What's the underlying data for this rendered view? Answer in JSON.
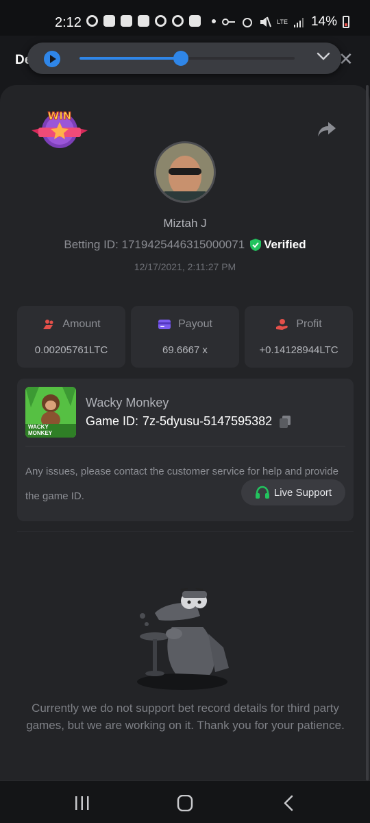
{
  "status_bar": {
    "time": "2:12",
    "network": "LTE",
    "battery": "14%"
  },
  "header": {
    "title": "Details",
    "close_icon": "close-icon"
  },
  "media_player": {
    "progress": 0.47,
    "accent_color": "#2f86e8"
  },
  "bet": {
    "user_name": "Miztah J",
    "betting_id_label": "Betting ID: 1719425446315000071",
    "verified_label": "Verified",
    "date": "12/17/2021, 2:11:27 PM"
  },
  "stats": [
    {
      "label": "Amount",
      "value": "0.00205761LTC",
      "icon": "coins-icon",
      "color": "#e4504a"
    },
    {
      "label": "Payout",
      "value": "69.6667 x",
      "icon": "wallet-icon",
      "color": "#7b5cf0"
    },
    {
      "label": "Profit",
      "value": "+0.14128944LTC",
      "icon": "hand-coin-icon",
      "color": "#e4504a"
    }
  ],
  "game": {
    "name": "Wacky Monkey",
    "game_id_label": "Game ID:",
    "game_id": "7z-5dyusu-5147595382",
    "thumb_text": "WACKY MONKEY",
    "issue_text": "Any issues, please contact the customer service for help and provide the game ID.",
    "support_label": "Live Support"
  },
  "notice": "Currently we do not support bet record details for third party games, but we are working on it. Thank you for your patience.",
  "colors": {
    "verified_green": "#22c35e",
    "support_green": "#22c35e"
  }
}
